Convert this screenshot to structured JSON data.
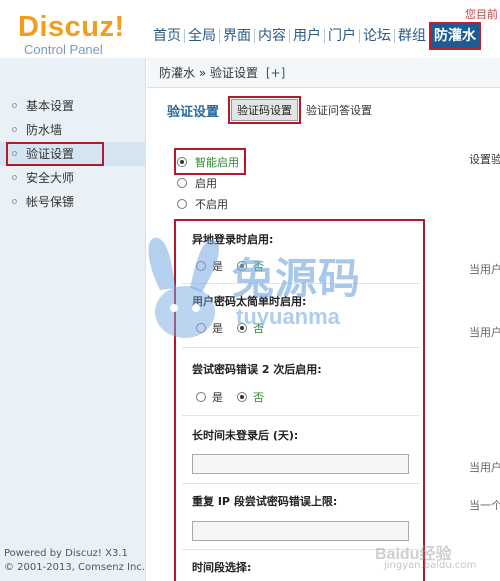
{
  "header": {
    "logo_main": "Discuz!",
    "logo_sub": "Control Panel",
    "top_right_link": "您目前",
    "nav": [
      "首页",
      "全局",
      "界面",
      "内容",
      "用户",
      "门户",
      "论坛",
      "群组"
    ],
    "nav_active": "防灌水"
  },
  "sidebar": {
    "items": [
      {
        "label": "基本设置"
      },
      {
        "label": "防水墙"
      },
      {
        "label": "验证设置"
      },
      {
        "label": "安全大师"
      },
      {
        "label": "帐号保镖"
      }
    ],
    "footer_line1": "Powered by Discuz! X3.1",
    "footer_line2": "© 2001-2013, Comsenz Inc."
  },
  "breadcrumb": {
    "section": "防灌水",
    "separator": "»",
    "page": "验证设置",
    "add": "[+]"
  },
  "main": {
    "title": "验证设置",
    "tab_active": "验证码设置",
    "tab_other": "验证问答设置",
    "right_header": "设置验",
    "right_notes": [
      "当用户",
      "当用户",
      "当用户",
      "当一个"
    ],
    "mode_options": [
      {
        "label": "智能启用",
        "checked": true
      },
      {
        "label": "启用",
        "checked": false
      },
      {
        "label": "不启用",
        "checked": false
      }
    ],
    "groups": {
      "remote_login": {
        "label": "异地登录时启用:",
        "yes": "是",
        "no": "否",
        "value": "否"
      },
      "simple_password": {
        "label": "用户密码太简单时启用:",
        "yes": "是",
        "no": "否",
        "value": "否"
      },
      "wrong_password": {
        "label": "尝试密码错误 2 次后启用:",
        "yes": "是",
        "no": "否",
        "value": "否"
      },
      "long_inactive": {
        "label": "长时间未登录后 (天):",
        "value": ""
      },
      "repeat_ip": {
        "label": "重复 IP 段尝试密码错误上限:",
        "value": ""
      },
      "time_period": {
        "label": "时间段选择:"
      }
    }
  },
  "watermarks": {
    "brand_cn": "兔源码",
    "brand_en": "tuyuanma",
    "baidu": "Baidu经验",
    "domain": "jingyan.baidu.com"
  },
  "colors": {
    "logo_orange": "#f29e1c",
    "nav_active_bg": "#1f5b93",
    "highlight_red": "#b21a2a",
    "sidebar_bg": "#e9f0f6",
    "green_text": "#2e8b2e"
  }
}
